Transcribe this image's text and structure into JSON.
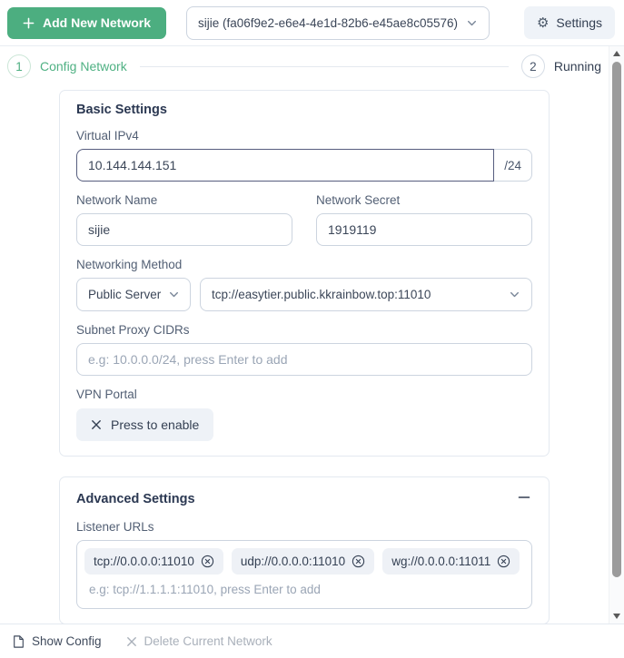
{
  "header": {
    "add_network_button": "Add New Network",
    "network_select_value": "sijie (fa06f9e2-e6e4-4e1d-82b6-e45ae8c05576)",
    "settings_button": "Settings"
  },
  "stepper": {
    "step1_number": "1",
    "step1_label": "Config Network",
    "step2_number": "2",
    "step2_label": "Running"
  },
  "basic": {
    "title": "Basic Settings",
    "virtual_ipv4_label": "Virtual IPv4",
    "virtual_ipv4_value": "10.144.144.151",
    "virtual_ipv4_suffix": "/24",
    "network_name_label": "Network Name",
    "network_name_value": "sijie",
    "network_secret_label": "Network Secret",
    "network_secret_value": "1919119",
    "networking_method_label": "Networking Method",
    "method_value": "Public Server",
    "server_value": "tcp://easytier.public.kkrainbow.top:11010",
    "subnet_proxy_label": "Subnet Proxy CIDRs",
    "subnet_proxy_placeholder": "e.g: 10.0.0.0/24, press Enter to add",
    "vpn_portal_label": "VPN Portal",
    "vpn_portal_button": "Press to enable"
  },
  "advanced": {
    "title": "Advanced Settings",
    "listener_urls_label": "Listener URLs",
    "listener_chips": [
      "tcp://0.0.0.0:11010",
      "udp://0.0.0.0:11010",
      "wg://0.0.0.0:11011"
    ],
    "listener_placeholder": "e.g: tcp://1.1.1.1:11010, press Enter to add"
  },
  "footer": {
    "show_config": "Show Config",
    "delete_network": "Delete Current Network"
  },
  "icons": {
    "gear_glyph": "⚙",
    "names": [
      "plus-icon",
      "chevron-down-icon",
      "gear-icon",
      "x-icon",
      "circle-x-icon",
      "minus-icon",
      "file-config-icon",
      "scroll-up-icon",
      "scroll-down-icon"
    ]
  },
  "colors": {
    "primary_green": "#4cae80",
    "active_step_green": "#4fb183",
    "text_dark": "#33415c",
    "label_gray": "#525f74",
    "input_border": "#ccd4df",
    "focused_input_border": "#565d7e",
    "card_border": "#e4e9f0",
    "placeholder_gray": "#9aa5b5",
    "chip_bg": "#eef1f6",
    "settings_btn_bg": "#eff3f8"
  }
}
